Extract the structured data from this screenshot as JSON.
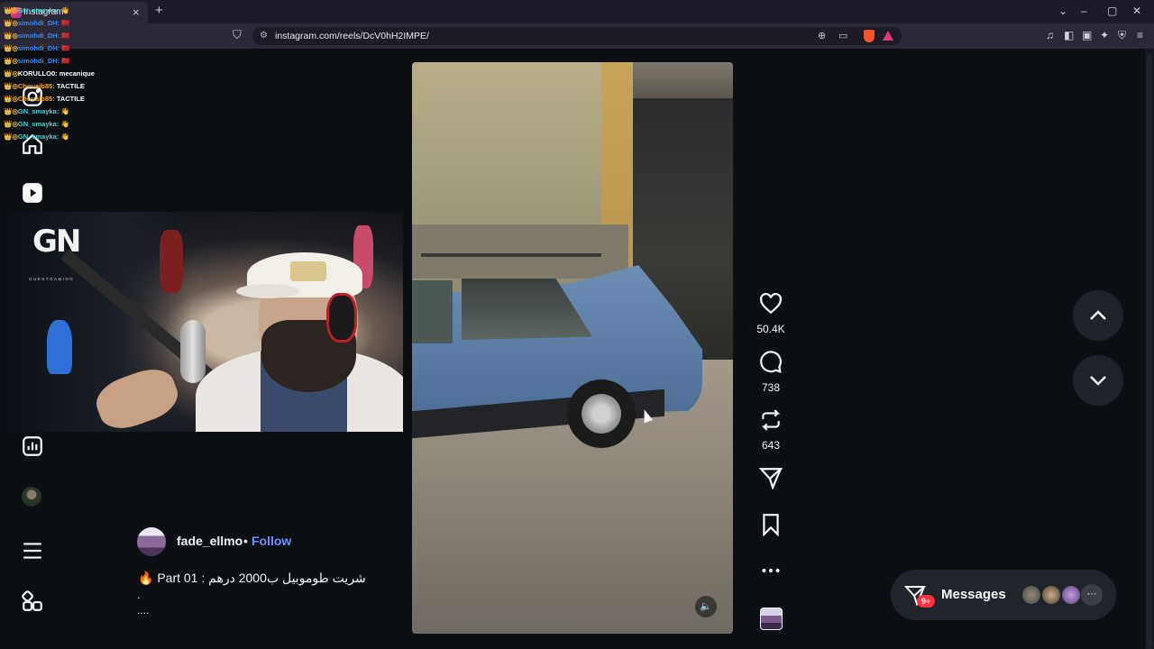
{
  "browser": {
    "tab_title": "Instagram",
    "url": "instagram.com/reels/DcV0hH2IMPE/",
    "new_tab_symbol": "+",
    "close_symbol": "×"
  },
  "chat": [
    {
      "user": "GN_smayka:",
      "msg": "👋",
      "user_color": "#3fd6d6"
    },
    {
      "user": "simohdi_DH:",
      "msg": "🇲🇦",
      "user_color": "#2f8cff"
    },
    {
      "user": "simohdi_DH:",
      "msg": "🇲🇦",
      "user_color": "#2f8cff"
    },
    {
      "user": "simohdi_DH:",
      "msg": "🇲🇦",
      "user_color": "#2f8cff"
    },
    {
      "user": "simohdi_DH:",
      "msg": "🇲🇦",
      "user_color": "#2f8cff"
    },
    {
      "user": "KORULLO0:",
      "msg": "mecanique",
      "user_color": "#ffffff"
    },
    {
      "user": "Chouaib85:",
      "msg": "TACTILE",
      "user_color": "#f7a533"
    },
    {
      "user": "Chouaib85:",
      "msg": "TACTILE",
      "user_color": "#f7a533"
    },
    {
      "user": "GN_smayka:",
      "msg": "👋",
      "user_color": "#3fd6d6"
    },
    {
      "user": "GN_smayka:",
      "msg": "👋",
      "user_color": "#3fd6d6"
    },
    {
      "user": "GN_smayka:",
      "msg": "👋",
      "user_color": "#3fd6d6"
    }
  ],
  "webcam": {
    "logo_text": "GN",
    "logo_subtext": "GUESTGAMING"
  },
  "reel": {
    "likes": "50.4K",
    "comments": "738",
    "reposts": "643",
    "author": "fade_ellmo",
    "separator": "•",
    "follow_label": "Follow",
    "caption": "🔥 Part 01 : شريت طوموبيل ب2000 درهم",
    "caption_line2": ".",
    "caption_line3": "...."
  },
  "messages": {
    "label": "Messages",
    "badge": "9+",
    "more": "···"
  },
  "icons": {
    "home": "home-icon",
    "reels": "reels-icon",
    "explore": "explore-icon",
    "insights": "insights-icon",
    "profile": "profile-avatar",
    "menu": "hamburger-icon",
    "more": "apps-grid-icon"
  },
  "colors": {
    "background": "#0c0f14",
    "follow": "#6e8fff",
    "badge": "#ff3040"
  }
}
